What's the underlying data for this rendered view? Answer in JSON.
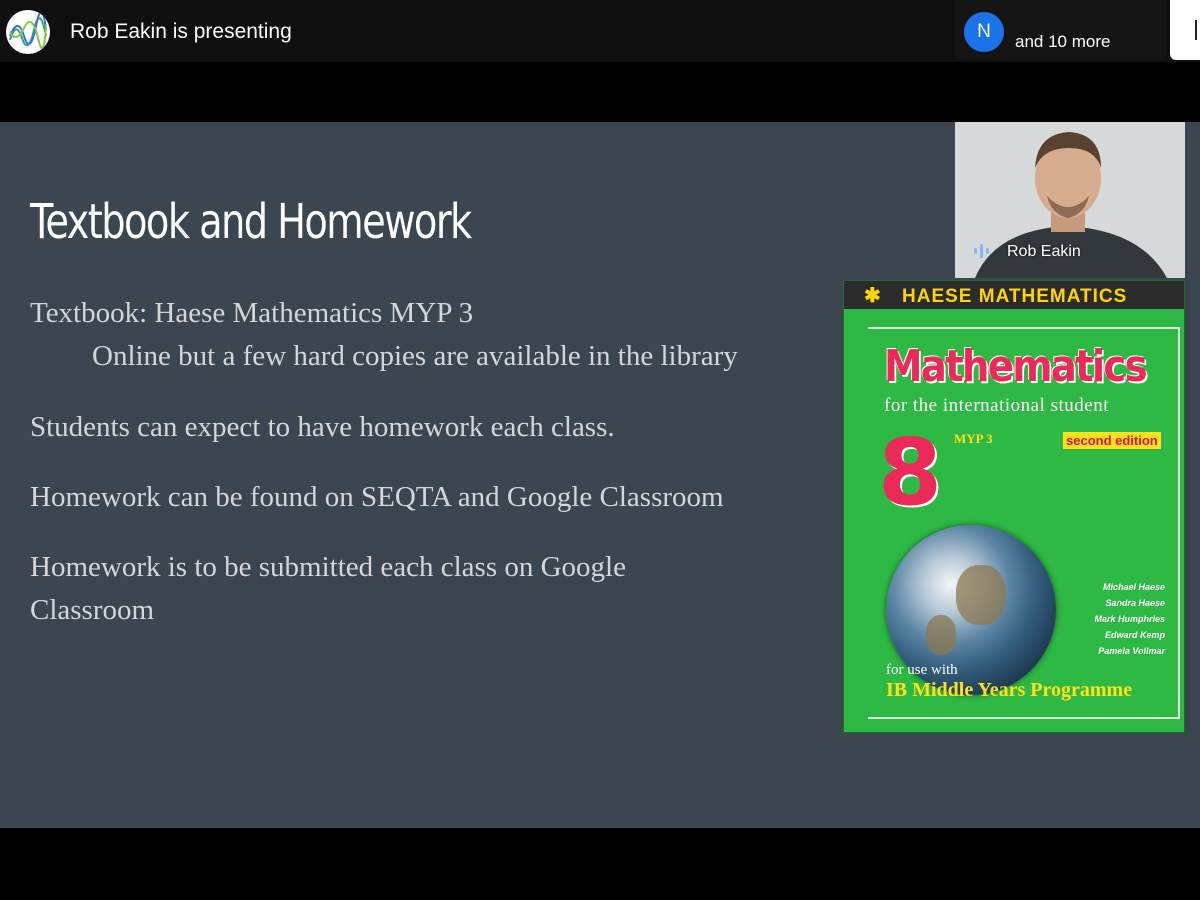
{
  "topbar": {
    "logo_icon": "meeting-app-logo-icon",
    "presenting_text": "Rob Eakin is presenting",
    "participants": {
      "avatar_initial": "N",
      "avatar_color": "#1a73e8",
      "more_text": "and 10 more"
    }
  },
  "slide": {
    "background_color": "#3b4651",
    "title": "Textbook and Homework",
    "lines": {
      "textbook": "Textbook: Haese Mathematics MYP 3",
      "textbook_note": "Online but a few hard copies are available in the library",
      "expect": "Students can expect to have homework each class.",
      "found": "Homework can be found on SEQTA and Google Classroom",
      "submitted_1": "Homework is to be submitted each class on Google",
      "submitted_2": "Classroom"
    }
  },
  "speaker": {
    "name": "Rob Eakin",
    "mic_icon": "speaking-indicator-icon"
  },
  "book": {
    "header_star": "✱",
    "header": "HAESE MATHEMATICS",
    "title": "Mathematics",
    "subtitle": "for the international student",
    "number": "8",
    "myp": "MYP 3",
    "edition": "second edition",
    "authors": [
      "Michael Haese",
      "Sandra Haese",
      "Mark Humphries",
      "Edward Kemp",
      "Pamela Vollmar"
    ],
    "for_use": "for use with",
    "programme": "IB Middle Years Programme",
    "cover_color": "#2eb844",
    "title_color": "#ec2a5a"
  }
}
